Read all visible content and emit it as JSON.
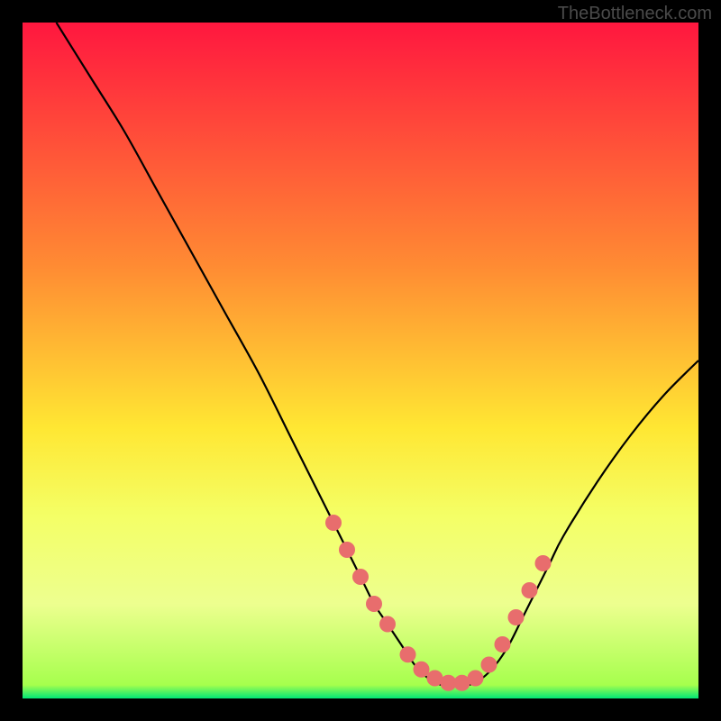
{
  "watermark": "TheBottleneck.com",
  "chart_data": {
    "type": "line",
    "title": "",
    "xlabel": "",
    "ylabel": "",
    "xlim": [
      0,
      100
    ],
    "ylim": [
      0,
      100
    ],
    "curve": {
      "x": [
        5,
        10,
        15,
        20,
        25,
        30,
        35,
        40,
        45,
        50,
        52,
        54,
        56,
        58,
        60,
        62,
        64,
        66,
        68,
        70,
        72,
        74,
        76,
        78,
        80,
        85,
        90,
        95,
        100
      ],
      "y": [
        100,
        92,
        84,
        75,
        66,
        57,
        48,
        38,
        28,
        18,
        14,
        11,
        8,
        5,
        3,
        2,
        2,
        2,
        3,
        5,
        8,
        12,
        16,
        20,
        24,
        32,
        39,
        45,
        50
      ]
    },
    "markers": {
      "x": [
        46,
        48,
        50,
        52,
        54,
        57,
        59,
        61,
        63,
        65,
        67,
        69,
        71,
        73,
        75,
        77
      ],
      "y": [
        26,
        22,
        18,
        14,
        11,
        6.5,
        4.3,
        3,
        2.3,
        2.3,
        3,
        5,
        8,
        12,
        16,
        20
      ]
    },
    "background": {
      "gradient_top": "#ff173f",
      "gradient_mid": "#ffe733",
      "gradient_band_top": "#f4ff66",
      "gradient_band_bottom": "#a6ff4d",
      "gradient_bottom": "#00e676",
      "band_start_pct": 73,
      "band_end_pct": 98
    },
    "curve_color": "#000000",
    "marker_color": "#e86d6d",
    "marker_radius": 9
  }
}
